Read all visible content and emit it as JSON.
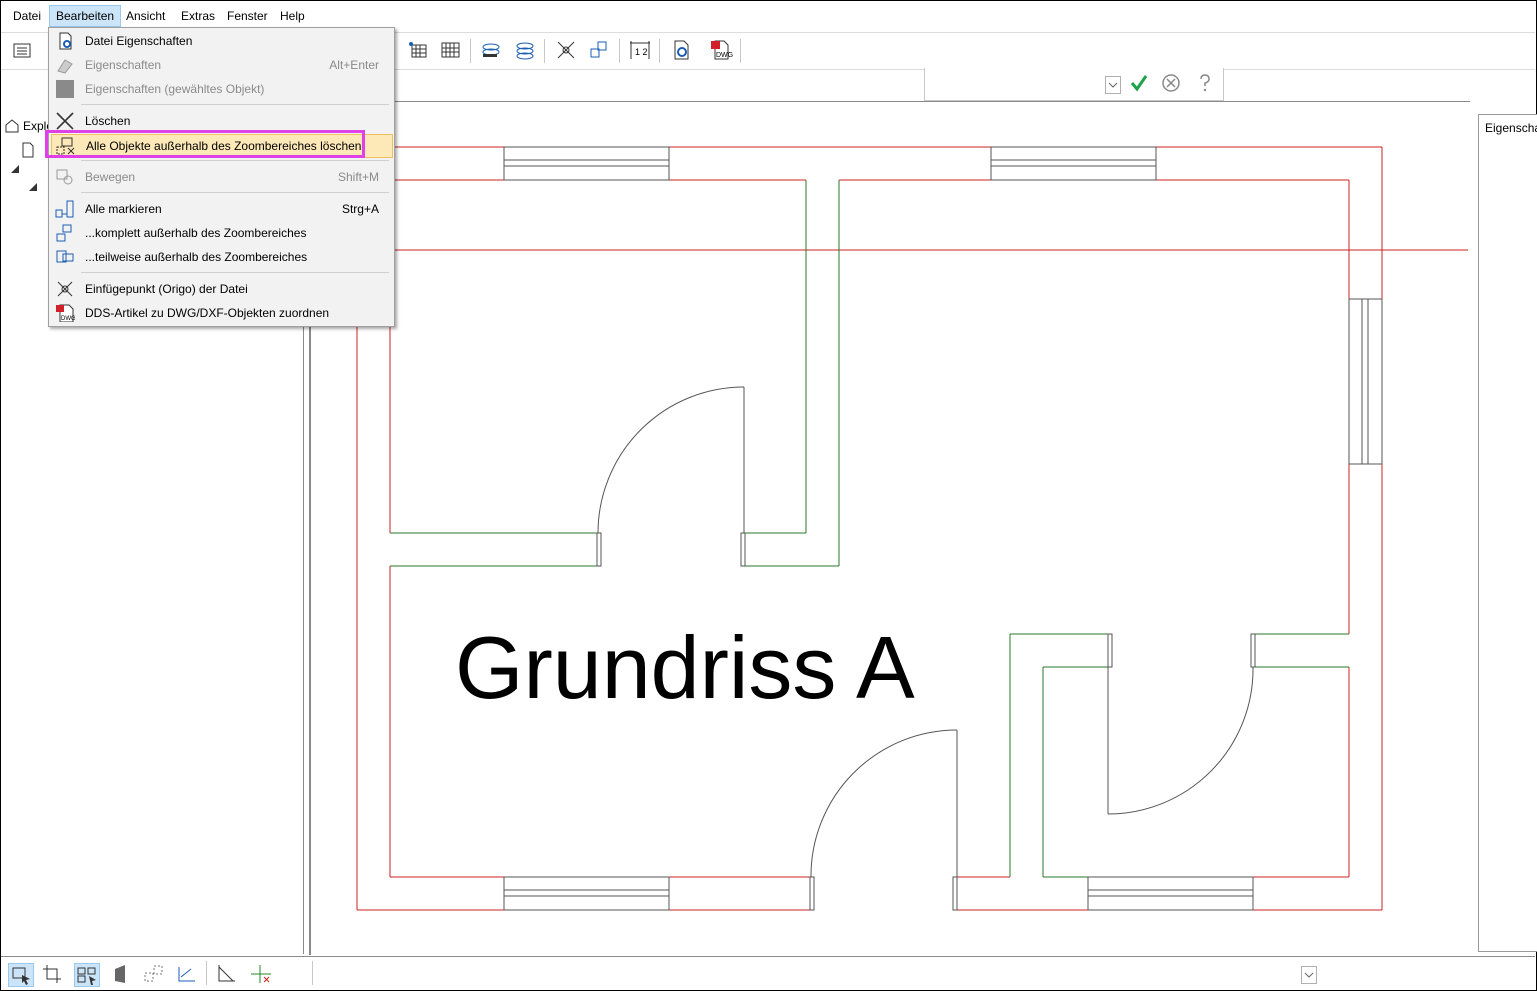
{
  "menubar": {
    "items": [
      "Datei",
      "Bearbeiten",
      "Ansicht",
      "Extras",
      "Fenster",
      "Help"
    ]
  },
  "edit_menu": {
    "items": [
      {
        "label": "Datei Eigenschaften",
        "shortcut": "",
        "disabled": false,
        "icon": "file-properties-icon"
      },
      {
        "label": "Eigenschaften",
        "shortcut": "Alt+Enter",
        "disabled": true,
        "icon": "properties-icon"
      },
      {
        "label": "Eigenschaften (gewähltes Objekt)",
        "shortcut": "",
        "disabled": true,
        "icon": "object-properties-icon"
      },
      {
        "label": "Löschen",
        "shortcut": "",
        "disabled": false,
        "icon": "delete-x-icon"
      },
      {
        "label": "Alle Objekte außerhalb des Zoombereiches löschen",
        "shortcut": "",
        "disabled": false,
        "highlighted": true,
        "icon": "delete-outside-zoom-icon"
      },
      {
        "label": "Bewegen",
        "shortcut": "Shift+M",
        "disabled": true,
        "icon": "move-icon"
      },
      {
        "label": "Alle markieren",
        "shortcut": "Strg+A",
        "disabled": false,
        "icon": "select-all-icon"
      },
      {
        "label": "...komplett außerhalb des Zoombereiches",
        "shortcut": "",
        "disabled": false,
        "icon": "select-outside-complete-icon"
      },
      {
        "label": "...teilweise außerhalb des Zoombereiches",
        "shortcut": "",
        "disabled": false,
        "icon": "select-outside-partial-icon"
      },
      {
        "label": "Einfügepunkt (Origo) der Datei",
        "shortcut": "",
        "disabled": false,
        "icon": "origin-point-icon"
      },
      {
        "label": "DDS-Artikel zu DWG/DXF-Objekten zuordnen",
        "shortcut": "",
        "disabled": false,
        "icon": "dwg-assign-icon"
      }
    ]
  },
  "explorer": {
    "tab_label": "Explo"
  },
  "properties_panel": {
    "tab_label": "Eigenscha"
  },
  "drawing": {
    "title_text": "Grundriss A"
  },
  "colors": {
    "wall": "#cc2222",
    "inner_wall": "#2a7a2a",
    "accent": "#e040e8",
    "highlight": "#fde8b8",
    "confirm": "#1aa34a"
  }
}
